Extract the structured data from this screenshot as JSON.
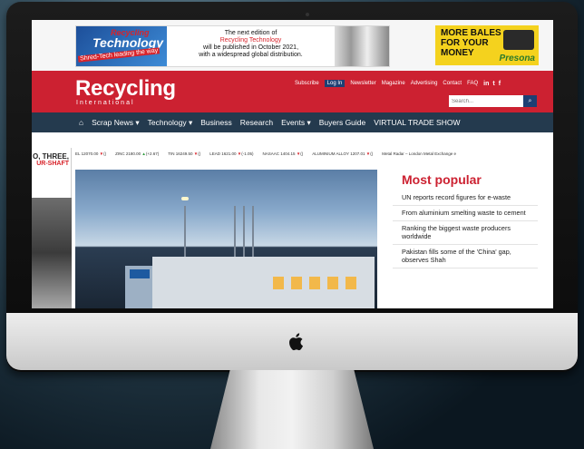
{
  "ads": {
    "banner_left": {
      "logo_small": "Recycling",
      "logo_big": "Technology",
      "logo_tagline": "Shred-Tech leading the way",
      "line1": "The next edition of",
      "line2": "Recycling Technology",
      "line3": "will be published in October 2021,",
      "line4": "with a widespread global distribution."
    },
    "banner_right": {
      "line1": "MORE BALES",
      "line2": "FOR YOUR",
      "line3": "MONEY",
      "brand": "Presona"
    },
    "side": {
      "line1": "O, THREE,",
      "line2": "UR-SHAFT"
    }
  },
  "header": {
    "brand": "Recycling",
    "brand_sub": "International",
    "links": [
      "Subscribe",
      "Log In",
      "Newsletter",
      "Magazine",
      "Advertising",
      "Contact",
      "FAQ"
    ],
    "social": [
      "in",
      "t",
      "f"
    ],
    "search_placeholder": "Search...",
    "search_icon": "search-icon",
    "accent": "#cc2131"
  },
  "nav": {
    "home_icon": "home-icon",
    "items": [
      "Scrap News ▾",
      "Technology ▾",
      "Business",
      "Research",
      "Events ▾",
      "Buyers Guide",
      "VIRTUAL TRADE SHOW"
    ]
  },
  "ticker": [
    {
      "text": "EL 12070.00",
      "dir": "down",
      "change": "()"
    },
    {
      "text": "ZINC 2180.00",
      "dir": "up",
      "change": "(+2.67)"
    },
    {
      "text": "TIN 16249.50",
      "dir": "down",
      "change": "()"
    },
    {
      "text": "LEAD 1621.00",
      "dir": "down",
      "change": "(-1.05)"
    },
    {
      "text": "NASAAC 1404.15",
      "dir": "down",
      "change": "()"
    },
    {
      "text": "ALUMINIUM ALLOY 1207.01",
      "dir": "down",
      "change": "()"
    },
    {
      "text": "Metal Radar – London Metal Exchange e",
      "dir": "",
      "change": ""
    }
  ],
  "popular": {
    "title": "Most popular",
    "items": [
      "UN reports record figures for e-waste",
      "From aluminium smelting waste to cement",
      "Ranking the biggest waste producers worldwide",
      "Pakistan fills some of the 'China' gap, observes Shah"
    ]
  }
}
